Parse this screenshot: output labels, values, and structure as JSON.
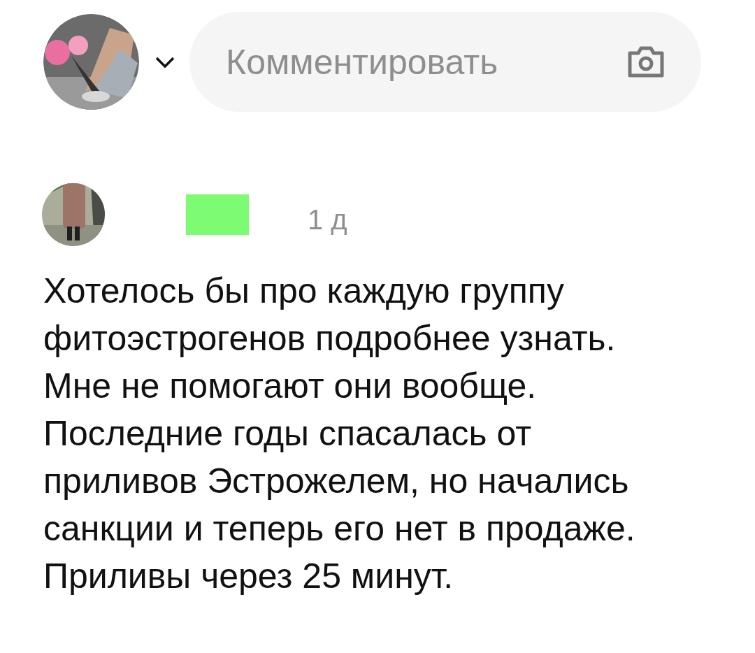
{
  "composer": {
    "placeholder": "Комментировать"
  },
  "comment": {
    "time": "1 д",
    "text": "Хотелось бы про каждую группу фитоэстрогенов подробнее узнать. Мне не помогают они вообще. Последние годы спасалась от приливов Эстрожелем, но начались санкции и теперь его нет в продаже. Приливы через 25 минут."
  }
}
